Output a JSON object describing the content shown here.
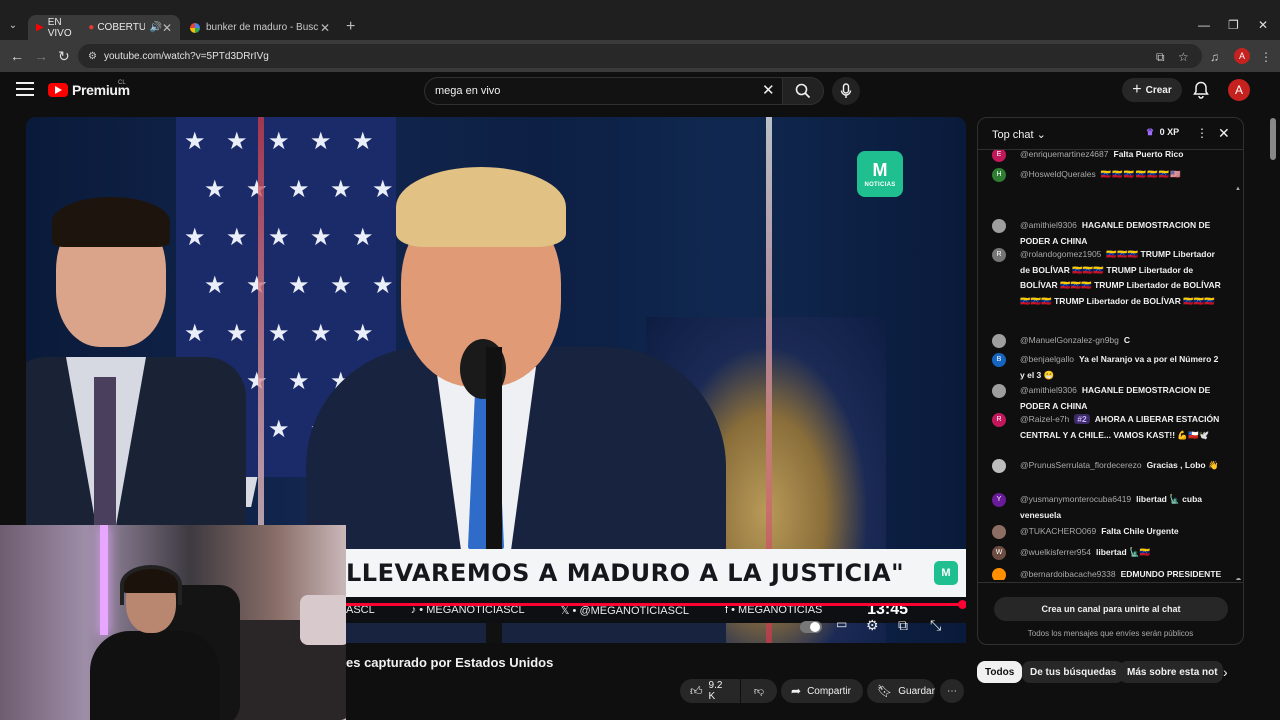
{
  "browser": {
    "tabs": [
      {
        "live": "EN VIVO",
        "title": "COBERTURA E",
        "active": true
      },
      {
        "title": "bunker de maduro - Buscar con",
        "active": false
      }
    ],
    "url": "youtube.com/watch?v=5PTd3DRrIVg",
    "profile_initial": "A"
  },
  "header": {
    "logo_text": "Premium",
    "region": "CL",
    "search_value": "mega en vivo",
    "create_label": "Crear",
    "avatar_initial": "A"
  },
  "video": {
    "channel_logo_label": "NOTICIAS",
    "headline": "LLEVAREMOS A MADURO A LA JUSTICIA\"",
    "ticker": [
      "ASCL",
      "♪ • MEGANOTICIASCL",
      "𝕏 • @MEGANOTICIASCL",
      "f • MEGANOTICIAS"
    ],
    "ticker_time": "13:45",
    "title": "es capturado por Estados Unidos",
    "progress_fraction": 0.99
  },
  "actions": {
    "like_count": "9.2 K",
    "share_label": "Compartir",
    "save_label": "Guardar"
  },
  "chat": {
    "mode_label": "Top chat",
    "xp_label": "0 XP",
    "messages": [
      {
        "initial": "E",
        "color": "#c2185b",
        "author": "@enriquemartinez4687",
        "text": "Falta Puerto Rico"
      },
      {
        "initial": "H",
        "color": "#2e7d32",
        "author": "@HosweldQuerales",
        "text": "🇻🇪🇻🇪🇻🇪🇻🇪🇻🇪🇻🇪🇺🇸"
      },
      {
        "initial": "",
        "color": "#9e9e9e",
        "author": "@amithiel9306",
        "text": "HAGANLE DEMOSTRACION DE PODER A CHINA"
      },
      {
        "initial": "R",
        "color": "#757575",
        "author": "@rolandogomez1905",
        "text": "🇻🇪🇻🇪🇻🇪 TRUMP Libertador de BOLÍVAR 🇻🇪🇻🇪🇻🇪 TRUMP Libertador de BOLÍVAR 🇻🇪🇻🇪🇻🇪 TRUMP Libertador de BOLÍVAR 🇻🇪🇻🇪🇻🇪 TRUMP Libertador de BOLÍVAR 🇻🇪🇻🇪🇻🇪"
      },
      {
        "initial": "",
        "color": "#9e9e9e",
        "author": "@ManuelGonzalez-gn9bg",
        "text": "C"
      },
      {
        "initial": "B",
        "color": "#1565c0",
        "author": "@benjaelgallo",
        "text": "Ya el Naranjo va a por el Número 2 y el 3 😁"
      },
      {
        "initial": "",
        "color": "#9e9e9e",
        "author": "@amithiel9306",
        "text": "HAGANLE DEMOSTRACION DE PODER A CHINA"
      },
      {
        "initial": "R",
        "color": "#c2185b",
        "author": "@Raizel-e7h",
        "badge": "#2",
        "text": "AHORA A LIBERAR ESTACIÓN CENTRAL Y A CHILE... VAMOS KAST!! 💪🇨🇱🕊️"
      },
      {
        "initial": "",
        "color": "#bdbdbd",
        "author": "@PrunusSerrulata_flordecerezo",
        "text": "Gracias , Lobo 👋"
      },
      {
        "initial": "Y",
        "color": "#6a1b9a",
        "author": "@yusmanymonterocuba6419",
        "text": "libertad 🗽 cuba venesuela"
      },
      {
        "initial": "",
        "color": "#8d6e63",
        "author": "@TUKACHERO069",
        "text": "Falta Chile Urgente"
      },
      {
        "initial": "W",
        "color": "#6d4c41",
        "author": "@wuelkisferrer954",
        "text": "libertad 🗽🇻🇪"
      },
      {
        "initial": "",
        "color": "#ff8f00",
        "author": "@bernardoibacache9338",
        "text": "EDMUNDO PRESIDENTE"
      }
    ],
    "join_label": "Crea un canal para unirte al chat",
    "public_note": "Todos los mensajes que envíes serán públicos"
  },
  "chips": [
    "Todos",
    "De tus búsquedas",
    "Más sobre esta not"
  ]
}
